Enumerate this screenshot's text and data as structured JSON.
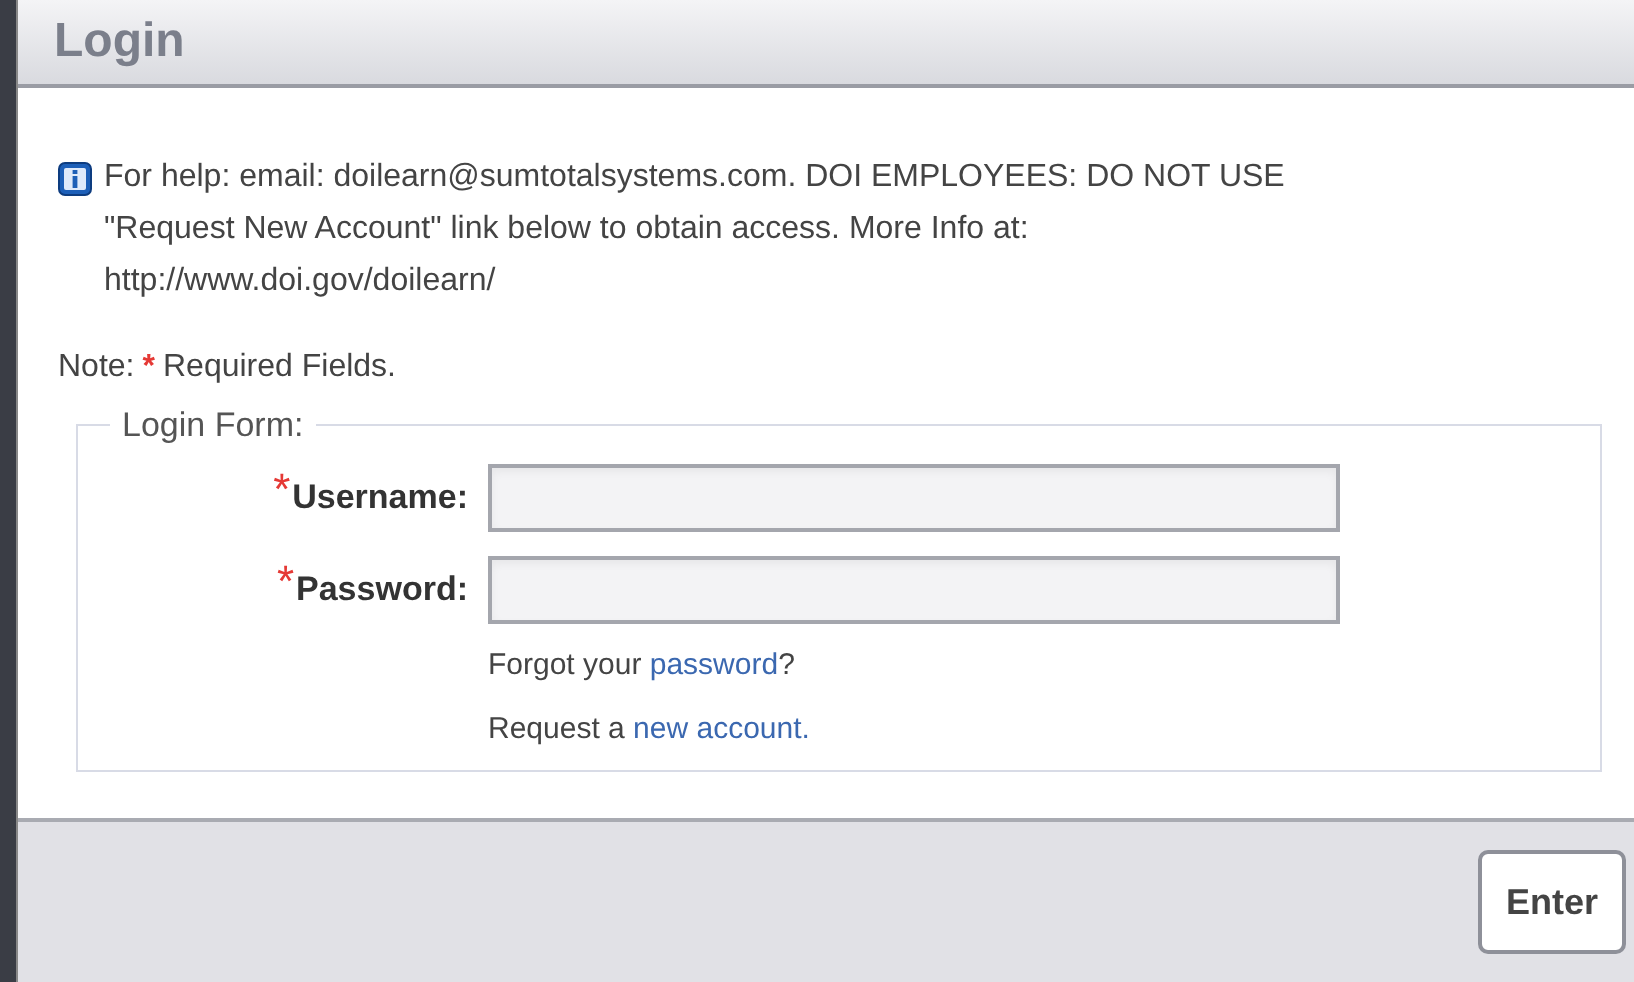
{
  "window": {
    "title": "Login"
  },
  "help_text": "For help: email: doilearn@sumtotalsystems.com. DOI EMPLOYEES: DO NOT USE \"Request New Account\" link below to obtain access. More Info at: http://www.doi.gov/doilearn/",
  "note": {
    "label": "Note:",
    "marker": "*",
    "text": "Required Fields."
  },
  "form": {
    "legend": "Login Form:",
    "fields": [
      {
        "label": "Username:",
        "marker": "*"
      },
      {
        "label": "Password:",
        "marker": "*"
      }
    ],
    "links": [
      {
        "before": "Forgot your ",
        "link": "password",
        "after": "?"
      },
      {
        "before": "Request a ",
        "link": "new account."
      }
    ]
  },
  "buttons": [
    "Enter"
  ]
}
